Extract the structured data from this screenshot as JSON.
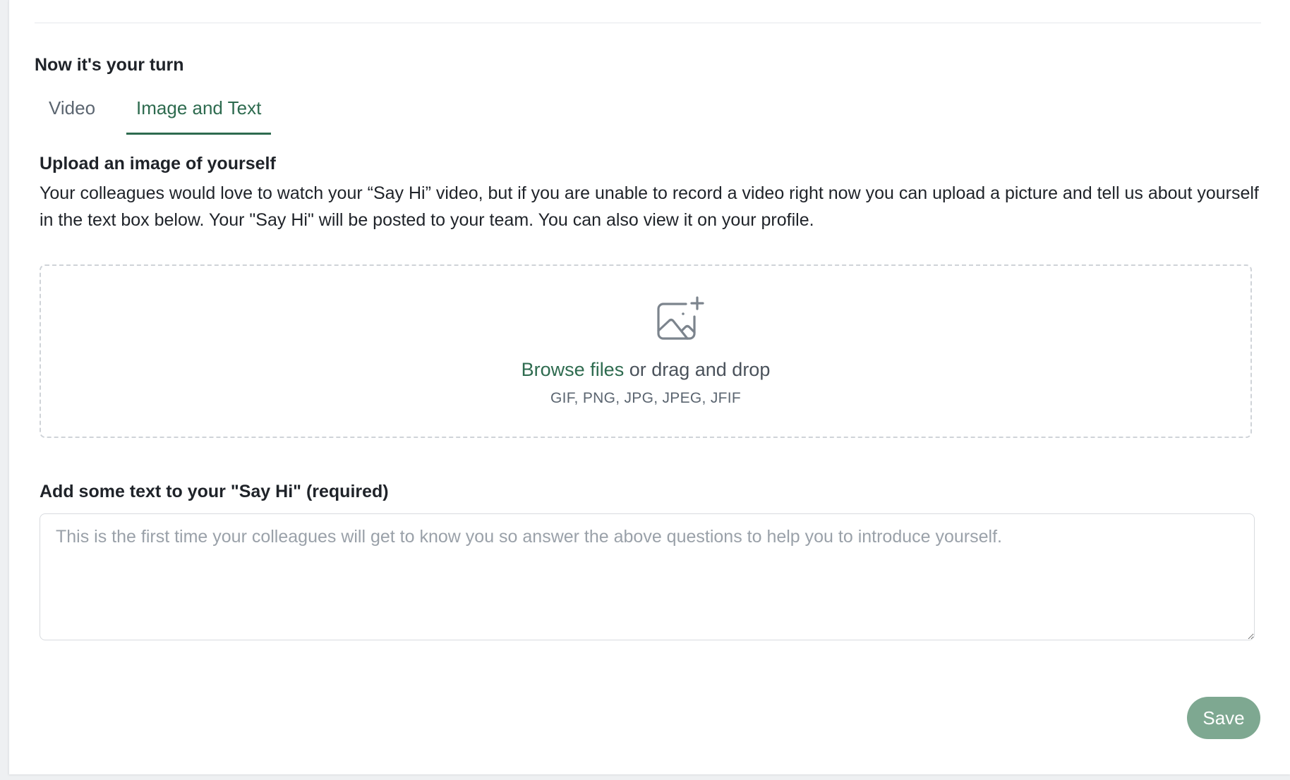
{
  "section": {
    "title": "Now it's your turn"
  },
  "tabs": [
    {
      "label": "Video",
      "active": false
    },
    {
      "label": "Image and Text",
      "active": true
    }
  ],
  "upload": {
    "heading": "Upload an image of yourself",
    "description": "Your colleagues would love to watch your “Say Hi” video, but if you are unable to record a video right now you can upload a picture and tell us about yourself in the text box below. Your \"Say Hi\" will be posted to your team. You can also view it on your profile.",
    "icon": "image-add-icon",
    "browse_label": "Browse files",
    "drag_label": " or drag and drop",
    "formats": "GIF, PNG, JPG, JPEG, JFIF"
  },
  "text_entry": {
    "label": "Add some text to your \"Say Hi\" (required)",
    "value": "",
    "placeholder": "This is the first time your colleagues will get to know you so answer the above questions to help you to introduce yourself."
  },
  "actions": {
    "save_label": "Save"
  },
  "colors": {
    "accent": "#2e6b4f",
    "save_button": "#7ea891",
    "dropzone_border": "#cfd3d8"
  }
}
